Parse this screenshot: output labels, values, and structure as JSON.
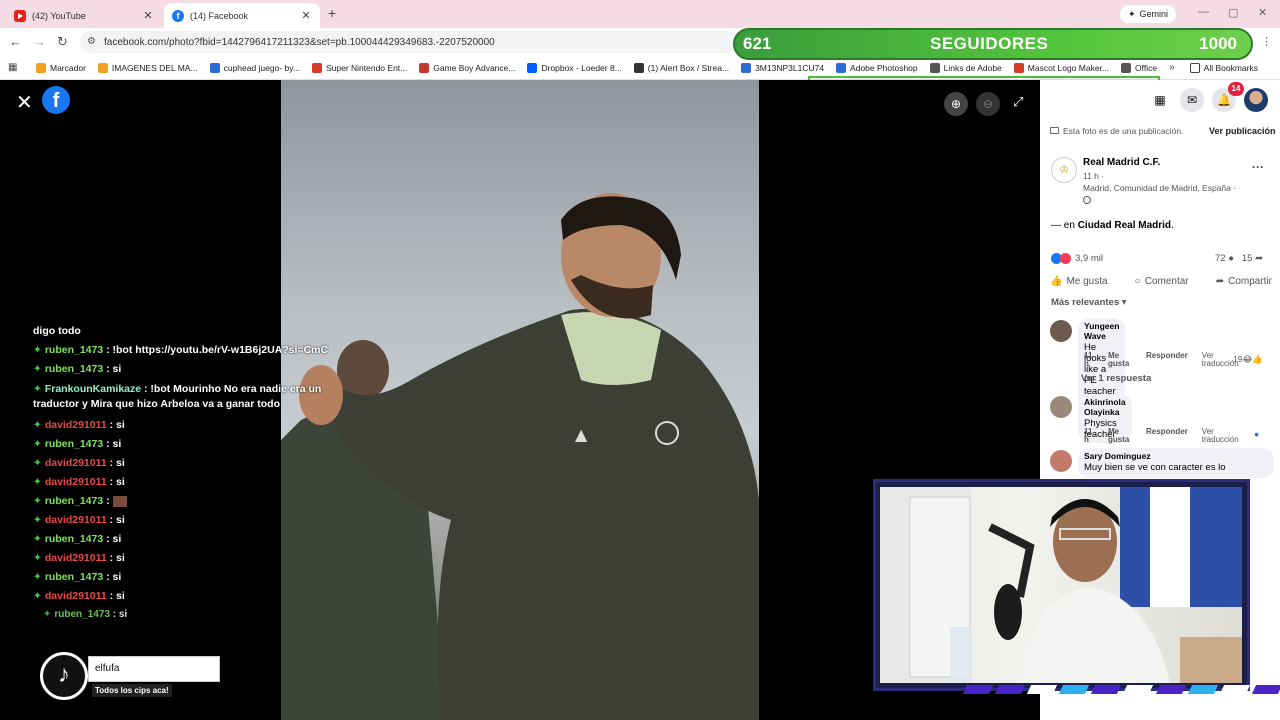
{
  "browser": {
    "tabs": [
      {
        "label": "(42) YouTube",
        "icon": "youtube-icon",
        "active": false
      },
      {
        "label": "(14) Facebook",
        "icon": "facebook-icon",
        "active": true
      }
    ],
    "new_tab": "+",
    "gemini_label": "Gemini",
    "url": "facebook.com/photo?fbid=1442796417211323&set=pb.100044429349683.-2207520000",
    "bookmarks": [
      {
        "label": "Marcador",
        "color": "#f0a020"
      },
      {
        "label": "IMAGENES DEL MA...",
        "color": "#f0a020"
      },
      {
        "label": "cuphead juego- by...",
        "color": "#2a6bd6"
      },
      {
        "label": "Super Nintendo Ent...",
        "color": "#d63b2a"
      },
      {
        "label": "Game Boy Advance...",
        "color": "#c0392b"
      },
      {
        "label": "Dropbox - Loeder 8...",
        "color": "#0061fe"
      },
      {
        "label": "(1) Alert Box / Strea...",
        "color": "#333333"
      },
      {
        "label": "3M13NP3L1CU74",
        "color": "#2a6bd6"
      },
      {
        "label": "Adobe Photoshop",
        "color": "#2a6bd6"
      },
      {
        "label": "Links de Adobe",
        "color": "#555555"
      },
      {
        "label": "Mascot Logo Maker...",
        "color": "#d63b2a"
      },
      {
        "label": "Office",
        "color": "#555555"
      }
    ],
    "more_bookmarks": "»",
    "all_bookmarks": "All Bookmarks"
  },
  "follower_goal": {
    "current": "621",
    "label": "SEGUIDORES",
    "goal": "1000"
  },
  "viewer": {
    "close": "✕",
    "fb_letter": "f"
  },
  "chat": [
    {
      "user": "",
      "text": "digo todo",
      "color": "white"
    },
    {
      "user": "ruben_1473",
      "text": " : !bot https://youtu.be/rV-w1B6j2UA?si=CmC",
      "color": "green"
    },
    {
      "user": "ruben_1473",
      "text": " : si",
      "color": "green"
    },
    {
      "user": "FrankounKamikaze",
      "text": " : !bot Mourinho No era nadie era un traductor y Mira que hizo Arbeloa va a ganar todo",
      "color": "cyan"
    },
    {
      "user": "david291011",
      "text": " : si",
      "color": "red"
    },
    {
      "user": "ruben_1473",
      "text": " : si",
      "color": "green"
    },
    {
      "user": "david291011",
      "text": " : si",
      "color": "red"
    },
    {
      "user": "david291011",
      "text": " : si",
      "color": "red"
    },
    {
      "user": "ruben_1473",
      "text": " : ",
      "color": "green"
    },
    {
      "user": "david291011",
      "text": " : si",
      "color": "red"
    },
    {
      "user": "ruben_1473",
      "text": " : si",
      "color": "green"
    },
    {
      "user": "david291011",
      "text": " : si",
      "color": "red"
    },
    {
      "user": "ruben_1473",
      "text": " : si",
      "color": "green"
    },
    {
      "user": "david291011",
      "text": " : si",
      "color": "red"
    },
    {
      "user": "ruben_1473",
      "text": " : si",
      "color": "green"
    }
  ],
  "tiktok": {
    "name": "elfufa",
    "sub": "Todos los cips aca!"
  },
  "panel": {
    "notif_count": "14",
    "pub_note": "Esta foto es de una publicación.",
    "ver_pub": "Ver publicación",
    "page_name": "Real Madrid C.F.",
    "time": "11 h ·",
    "location": "Madrid, Comunidad de Madrid, España ·",
    "en_prefix": "— en ",
    "en_place": "Ciudad Real Madrid",
    "en_suffix": ".",
    "reactions": "3,9 mil",
    "comments_count": "72",
    "shares_count": "15",
    "like": "Me gusta",
    "comment": "Comentar",
    "share": "Compartir",
    "relevant": "Más relevantes",
    "comments": [
      {
        "name": "Yungeen Wave",
        "text": "He looks like a PE teacher",
        "time": "11 h",
        "like": "Me gusta",
        "reply": "Responder",
        "translate": "Ver traducción",
        "react": "19"
      },
      {
        "name": "Akinrinola Olayinka",
        "text": "Physics teacher",
        "time": "11 h",
        "like": "Me gusta",
        "reply": "Responder",
        "translate": "Ver traducción",
        "react": ""
      },
      {
        "name": "Sary Dominguez",
        "text": "Muy bien se ve con caracter es lo",
        "time": "",
        "like": "",
        "reply": "",
        "translate": "",
        "react": ""
      }
    ],
    "replies": "Ver 1 respuesta"
  },
  "colors": {
    "accent": "#1877f2",
    "follow_green": "#53c33c",
    "chat_green": "#7fe35a",
    "chat_red": "#e84848"
  }
}
